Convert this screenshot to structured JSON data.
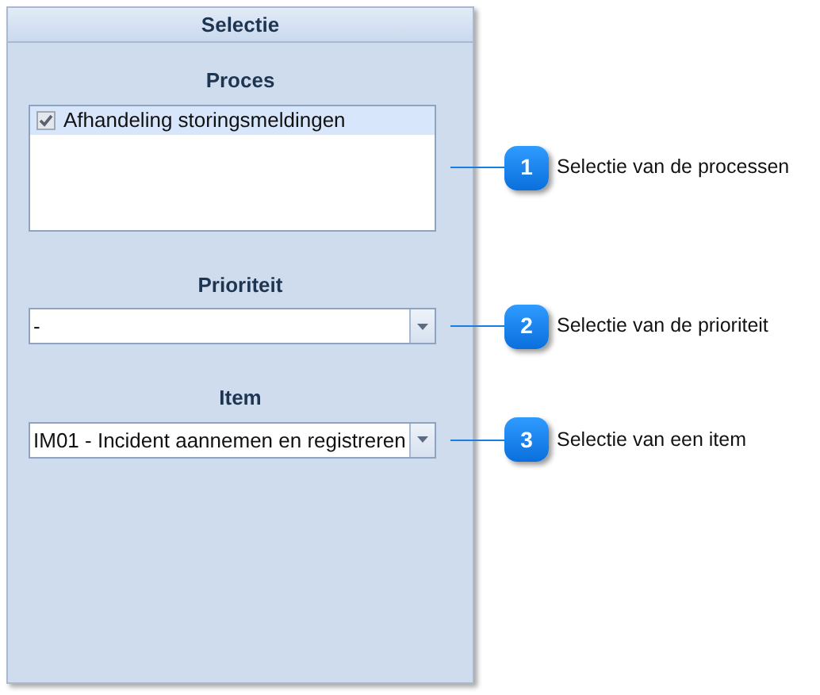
{
  "panel": {
    "title": "Selectie"
  },
  "sections": [
    {
      "kind": "list",
      "heading": "Proces",
      "items": [
        {
          "label": "Afhandeling storingsmeldingen",
          "checked": true,
          "selected": true
        }
      ],
      "callout": {
        "number": "1",
        "text": "Selectie van de processen"
      }
    },
    {
      "kind": "combo",
      "heading": "Prioriteit",
      "value": "-",
      "callout": {
        "number": "2",
        "text": "Selectie van de prioriteit"
      }
    },
    {
      "kind": "combo",
      "heading": "Item",
      "value": "IM01 - Incident aannemen en registreren",
      "callout": {
        "number": "3",
        "text": "Selectie van een item"
      }
    }
  ]
}
